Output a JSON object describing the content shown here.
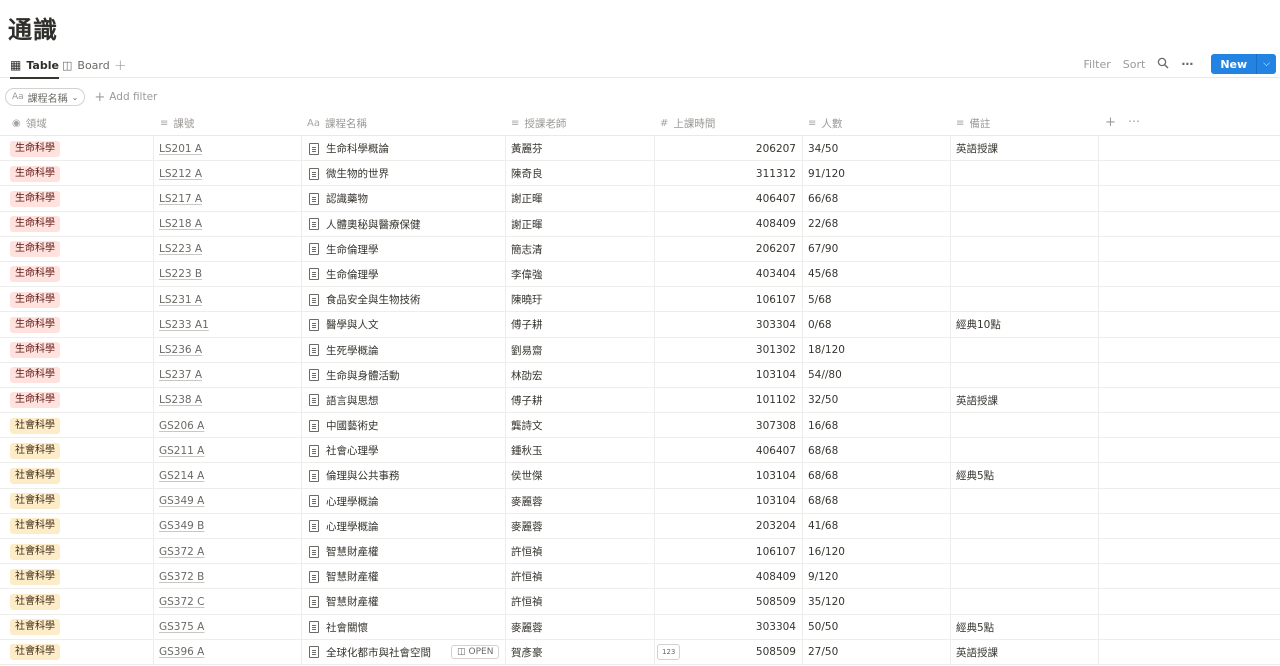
{
  "page": {
    "title": "通識"
  },
  "views": {
    "tabs": [
      {
        "label": "Table",
        "icon": "table-icon",
        "active": true
      },
      {
        "label": "Board",
        "icon": "board-icon",
        "active": false
      }
    ],
    "add": "+"
  },
  "actions": {
    "filter": "Filter",
    "sort": "Sort",
    "new": "New"
  },
  "filters": {
    "chip_label": "課程名稱",
    "add_filter": "Add filter"
  },
  "columns": [
    {
      "name": "領域",
      "icon": "select-icon"
    },
    {
      "name": "課號",
      "icon": "text-icon"
    },
    {
      "name": "課程名稱",
      "icon": "title-icon"
    },
    {
      "name": "授課老師",
      "icon": "text-icon"
    },
    {
      "name": "上課時間",
      "icon": "number-icon"
    },
    {
      "name": "人數",
      "icon": "text-icon"
    },
    {
      "name": "備註",
      "icon": "text-icon"
    }
  ],
  "colors": {
    "accent": "#2383e2",
    "tag_life_bg": "#ffe2dd",
    "tag_social_bg": "#fdecc8"
  },
  "rows": [
    {
      "field": "生命科學",
      "code": "LS201 A",
      "name": "生命科學概論",
      "teacher": "黃麗芬",
      "time": "206207",
      "count": "34/50",
      "note": "英語授課"
    },
    {
      "field": "生命科學",
      "code": "LS212 A",
      "name": "微生物的世界",
      "teacher": "陳奇良",
      "time": "311312",
      "count": "91/120",
      "note": ""
    },
    {
      "field": "生命科學",
      "code": "LS217 A",
      "name": "認識藥物",
      "teacher": "謝正暉",
      "time": "406407",
      "count": "66/68",
      "note": ""
    },
    {
      "field": "生命科學",
      "code": "LS218 A",
      "name": "人體奧秘與醫療保健",
      "teacher": "謝正暉",
      "time": "408409",
      "count": "22/68",
      "note": ""
    },
    {
      "field": "生命科學",
      "code": "LS223 A",
      "name": "生命倫理學",
      "teacher": "簡志清",
      "time": "206207",
      "count": "67/90",
      "note": ""
    },
    {
      "field": "生命科學",
      "code": "LS223 B",
      "name": "生命倫理學",
      "teacher": "李偉強",
      "time": "403404",
      "count": "45/68",
      "note": ""
    },
    {
      "field": "生命科學",
      "code": "LS231 A",
      "name": "食品安全與生物技術",
      "teacher": "陳曉玗",
      "time": "106107",
      "count": "5/68",
      "note": ""
    },
    {
      "field": "生命科學",
      "code": "LS233 A1",
      "name": "醫學與人文",
      "teacher": "傅子耕",
      "time": "303304",
      "count": "0/68",
      "note": "經典10點"
    },
    {
      "field": "生命科學",
      "code": "LS236 A",
      "name": "生死學概論",
      "teacher": "劉易齋",
      "time": "301302",
      "count": "18/120",
      "note": ""
    },
    {
      "field": "生命科學",
      "code": "LS237 A",
      "name": "生命與身體活動",
      "teacher": "林劭宏",
      "time": "103104",
      "count": "54//80",
      "note": ""
    },
    {
      "field": "生命科學",
      "code": "LS238 A",
      "name": "語言與思想",
      "teacher": "傅子耕",
      "time": "101102",
      "count": "32/50",
      "note": "英語授課"
    },
    {
      "field": "社會科學",
      "code": "GS206 A",
      "name": "中國藝術史",
      "teacher": "龔詩文",
      "time": "307308",
      "count": "16/68",
      "note": ""
    },
    {
      "field": "社會科學",
      "code": "GS211 A",
      "name": "社會心理學",
      "teacher": "鍾秋玉",
      "time": "406407",
      "count": "68/68",
      "note": ""
    },
    {
      "field": "社會科學",
      "code": "GS214 A",
      "name": "倫理與公共事務",
      "teacher": "侯世傑",
      "time": "103104",
      "count": "68/68",
      "note": "經典5點"
    },
    {
      "field": "社會科學",
      "code": "GS349 A",
      "name": "心理學概論",
      "teacher": "麥麗蓉",
      "time": "103104",
      "count": "68/68",
      "note": ""
    },
    {
      "field": "社會科學",
      "code": "GS349 B",
      "name": "心理學概論",
      "teacher": "麥麗蓉",
      "time": "203204",
      "count": "41/68",
      "note": ""
    },
    {
      "field": "社會科學",
      "code": "GS372 A",
      "name": "智慧財產權",
      "teacher": "許恒禎",
      "time": "106107",
      "count": "16/120",
      "note": ""
    },
    {
      "field": "社會科學",
      "code": "GS372 B",
      "name": "智慧財產權",
      "teacher": "許恒禎",
      "time": "408409",
      "count": "9/120",
      "note": ""
    },
    {
      "field": "社會科學",
      "code": "GS372 C",
      "name": "智慧財產權",
      "teacher": "許恒禎",
      "time": "508509",
      "count": "35/120",
      "note": ""
    },
    {
      "field": "社會科學",
      "code": "GS375 A",
      "name": "社會關懷",
      "teacher": "麥麗蓉",
      "time": "303304",
      "count": "50/50",
      "note": "經典5點"
    },
    {
      "field": "社會科學",
      "code": "GS396 A",
      "name": "全球化都市與社會空間",
      "teacher": "賀彥豪",
      "time": "508509",
      "count": "27/50",
      "note": "英語授課",
      "hover": true,
      "open_label": "OPEN",
      "number_badge": "123"
    }
  ]
}
